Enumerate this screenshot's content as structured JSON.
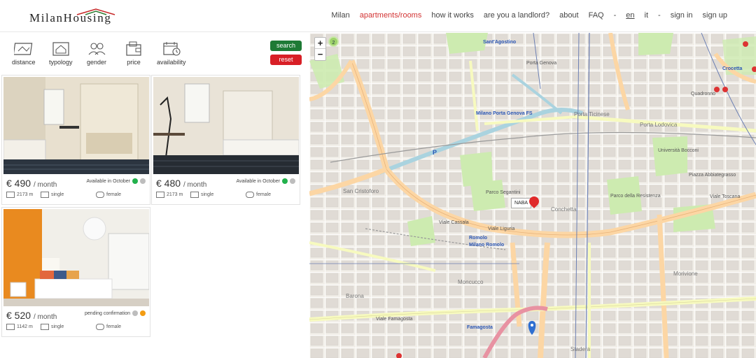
{
  "brand": {
    "name": "MilanHousing"
  },
  "nav": {
    "items": [
      {
        "label": "Milan",
        "style": ""
      },
      {
        "label": "apartments/rooms",
        "style": "active"
      },
      {
        "label": "how it works",
        "style": ""
      },
      {
        "label": "are you a landlord?",
        "style": ""
      },
      {
        "label": "about",
        "style": ""
      },
      {
        "label": "FAQ",
        "style": ""
      },
      {
        "label": "-",
        "style": "plain"
      },
      {
        "label": "en",
        "style": "underline"
      },
      {
        "label": "it",
        "style": ""
      },
      {
        "label": "-",
        "style": "plain"
      },
      {
        "label": "sign in",
        "style": ""
      },
      {
        "label": "sign up",
        "style": ""
      }
    ]
  },
  "filters": {
    "distance": "distance",
    "typology": "typology",
    "gender": "gender",
    "price": "price",
    "availability": "availability"
  },
  "actions": {
    "search": "search",
    "reset": "reset"
  },
  "listings": [
    {
      "price": "€ 490",
      "period": "/ month",
      "status": "Available in October",
      "dots": [
        "#22b14c",
        "#bdbdbd"
      ],
      "distance": "2173 m",
      "typology": "single",
      "gender": "female"
    },
    {
      "price": "€ 480",
      "period": "/ month",
      "status": "Available in October",
      "dots": [
        "#22b14c",
        "#bdbdbd"
      ],
      "distance": "2173 m",
      "typology": "single",
      "gender": "female"
    },
    {
      "price": "€ 520",
      "period": "/ month",
      "status": "pending confirmation",
      "dots": [
        "#bdbdbd",
        "#f39c12"
      ],
      "distance": "1142 m",
      "typology": "single",
      "gender": "female"
    }
  ],
  "map": {
    "zoom_in": "+",
    "zoom_out": "−",
    "cluster_count": "2",
    "marker_label": "NABA",
    "labels": [
      "Sant'Agostino",
      "Porta Genova",
      "Porta Ticinese",
      "Porta Lodovica",
      "Crocetta",
      "Quadronno",
      "Milano Porta Genova FS",
      "San Cristoforo",
      "Conchetta",
      "Viale Toscana",
      "Viale Liguria",
      "Viale Cassala",
      "Romolo",
      "Milano Romolo",
      "Moncucco",
      "Barona",
      "Famagosta",
      "Stadera",
      "Morivione",
      "Parco Segantini",
      "Parco della Resistenza",
      "Università Bocconi",
      "Piazza Abbiategrasso",
      "Viale Famagosta"
    ]
  }
}
